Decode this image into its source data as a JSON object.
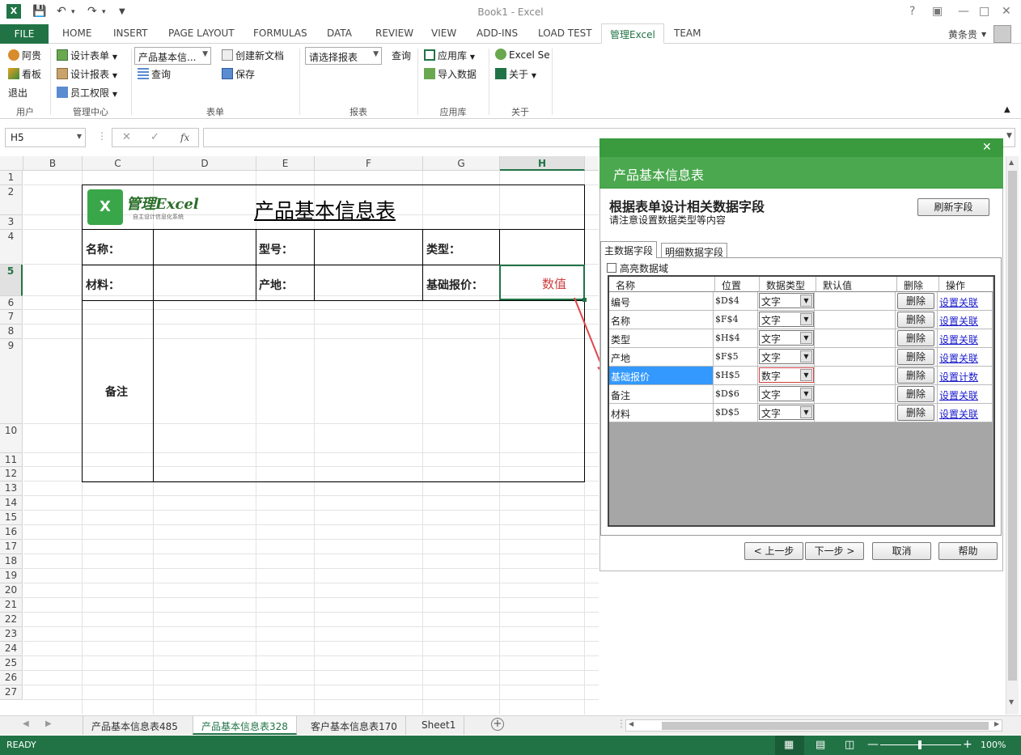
{
  "window": {
    "title": "Book1 - Excel",
    "help": "?"
  },
  "tabs": [
    "FILE",
    "HOME",
    "INSERT",
    "PAGE LAYOUT",
    "FORMULAS",
    "DATA",
    "REVIEW",
    "VIEW",
    "ADD-INS",
    "LOAD TEST",
    "管理Excel",
    "TEAM"
  ],
  "user": "黄条贵",
  "ribbon": {
    "user_group": {
      "label": "用户",
      "items": [
        "阿贵",
        "看板",
        "退出"
      ]
    },
    "admin_group": {
      "label": "管理中心",
      "items": [
        "设计表单",
        "设计报表",
        "员工权限"
      ]
    },
    "form_group": {
      "label": "表单",
      "combo": "产品基本信...",
      "items": [
        "创建新文档",
        "查询",
        "保存"
      ]
    },
    "report_group": {
      "label": "报表",
      "combo": "请选择报表",
      "query": "查询"
    },
    "app_group": {
      "label": "应用库",
      "items": [
        "应用库",
        "导入数据"
      ]
    },
    "about_group": {
      "label": "关于",
      "items": [
        "Excel Se",
        "关于"
      ]
    }
  },
  "formula": {
    "namebox": "H5",
    "fx": "fx"
  },
  "columns": [
    "B",
    "C",
    "D",
    "E",
    "F",
    "G",
    "H"
  ],
  "rows": [
    "1",
    "2",
    "3",
    "4",
    "5",
    "6",
    "7",
    "8",
    "9",
    "10",
    "11",
    "12",
    "13",
    "14",
    "15",
    "16",
    "17",
    "18",
    "19",
    "20",
    "21",
    "22",
    "23",
    "24",
    "25",
    "26",
    "27"
  ],
  "sheet_form": {
    "title": "产品基本信息表",
    "logo_text": "管理Excel",
    "logo_sub": "自主设计信息化系统",
    "labels": {
      "name": "名称：",
      "model": "型号：",
      "type": "类型：",
      "material": "材料：",
      "origin": "产地：",
      "base_price": "基础报价：",
      "note": "备注"
    },
    "h5_value": "数值"
  },
  "dialog": {
    "title": "产品基本信息表",
    "heading": "根据表单设计相关数据字段",
    "subheading": "请注意设置数据类型等内容",
    "refresh": "刷新字段",
    "tabs": [
      "主数据字段",
      "明细数据字段"
    ],
    "highlight": "高亮数据域",
    "table": {
      "headers": [
        "名称",
        "位置",
        "数据类型",
        "默认值",
        "删除",
        "操作"
      ],
      "rows": [
        {
          "name": "编号",
          "pos": "$D$4",
          "type": "文字",
          "del": "删除",
          "op": "设置关联"
        },
        {
          "name": "名称",
          "pos": "$F$4",
          "type": "文字",
          "del": "删除",
          "op": "设置关联"
        },
        {
          "name": "类型",
          "pos": "$H$4",
          "type": "文字",
          "del": "删除",
          "op": "设置关联"
        },
        {
          "name": "产地",
          "pos": "$F$5",
          "type": "文字",
          "del": "删除",
          "op": "设置关联"
        },
        {
          "name": "基础报价",
          "pos": "$H$5",
          "type": "数字",
          "del": "删除",
          "op": "设置计数"
        },
        {
          "name": "备注",
          "pos": "$D$6",
          "type": "文字",
          "del": "删除",
          "op": "设置关联"
        },
        {
          "name": "材料",
          "pos": "$D$5",
          "type": "文字",
          "del": "删除",
          "op": "设置关联"
        }
      ]
    },
    "buttons": {
      "prev": "< 上一步",
      "next": "下一步 >",
      "cancel": "取消",
      "help": "帮助"
    }
  },
  "sheets": [
    "产品基本信息表485",
    "产品基本信息表328",
    "客户基本信息表170",
    "Sheet1"
  ],
  "status": {
    "ready": "READY",
    "zoom": "100%"
  },
  "colors": {
    "excel_green": "#217346",
    "dialog_green": "#4ba84f",
    "selected_row": "#3399ff",
    "arrow": "#e0464a"
  }
}
